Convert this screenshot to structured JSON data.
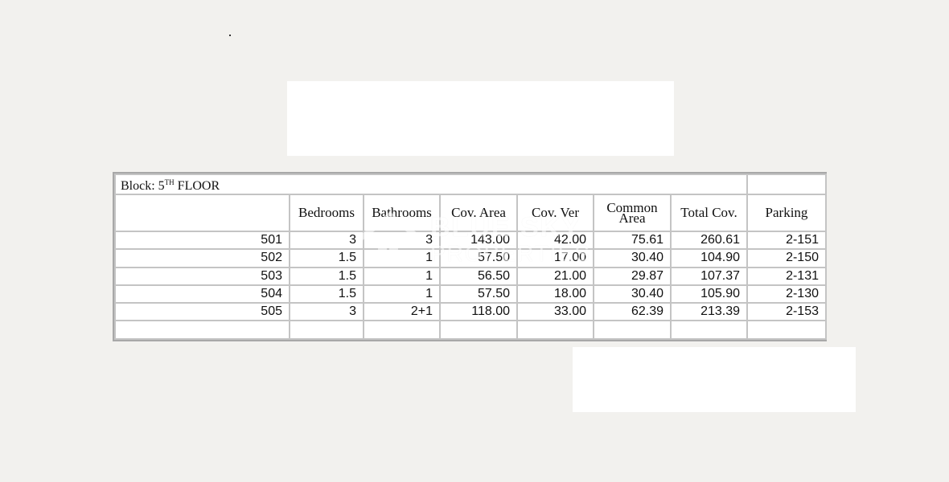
{
  "table": {
    "block_label": "Block: 5",
    "block_sup": "TH",
    "block_floor": " FLOOR",
    "headers": [
      "Bedrooms",
      "Bathrooms",
      "Cov. Area",
      "Cov. Ver",
      "Common Area",
      "Total Cov.",
      "Parking"
    ],
    "rows": [
      [
        "501",
        "3",
        "3",
        "143.00",
        "42.00",
        "75.61",
        "260.61",
        "2-151"
      ],
      [
        "502",
        "1.5",
        "1",
        "57.50",
        "17.00",
        "30.40",
        "104.90",
        "2-150"
      ],
      [
        "503",
        "1.5",
        "1",
        "56.50",
        "21.00",
        "29.87",
        "107.37",
        "2-131"
      ],
      [
        "504",
        "1.5",
        "1",
        "57.50",
        "18.00",
        "30.40",
        "105.90",
        "2-130"
      ],
      [
        "505",
        "3",
        "2+1",
        "118.00",
        "33.00",
        "62.39",
        "213.39",
        "2-153"
      ]
    ]
  },
  "watermark": {
    "line1": "BLUE SKY",
    "line2": "PROPERTIES",
    "icon": "house-logo-icon"
  }
}
